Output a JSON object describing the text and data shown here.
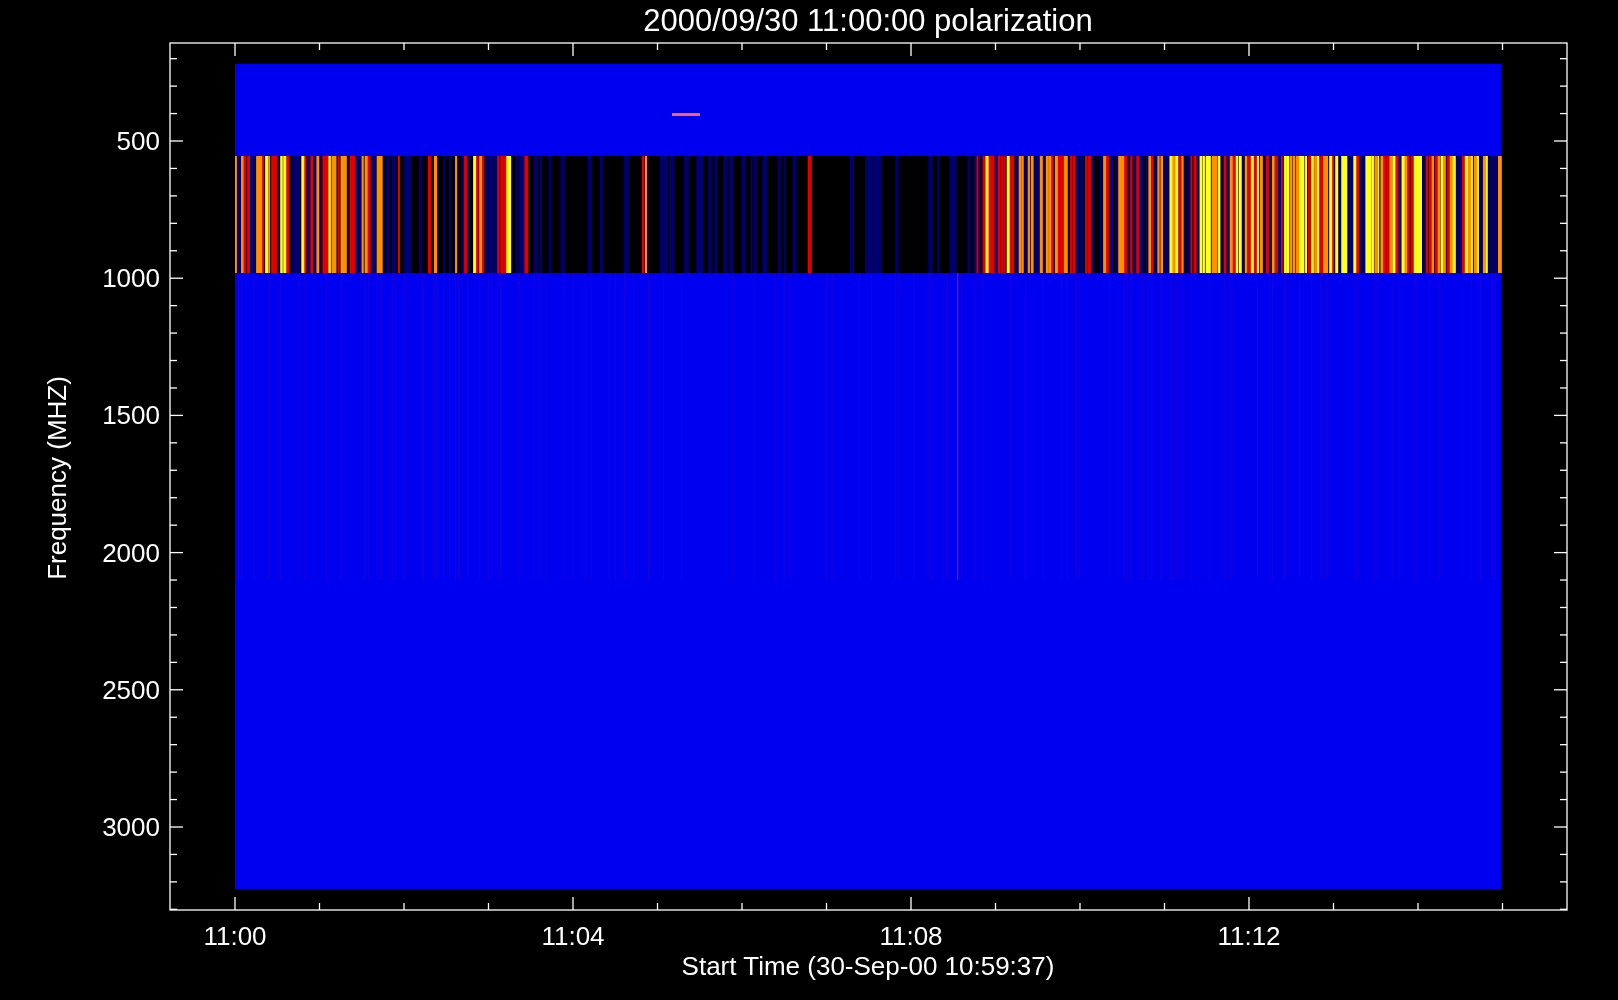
{
  "title": "2000/09/30 11:00:00 polarization",
  "xlabel": "Start Time (30-Sep-00 10:59:37)",
  "ylabel": "Frequency (MHZ)",
  "yticks": [
    "500",
    "1000",
    "1500",
    "2000",
    "2500",
    "3000"
  ],
  "xticks": [
    "11:00",
    "11:04",
    "11:08",
    "11:12"
  ]
}
